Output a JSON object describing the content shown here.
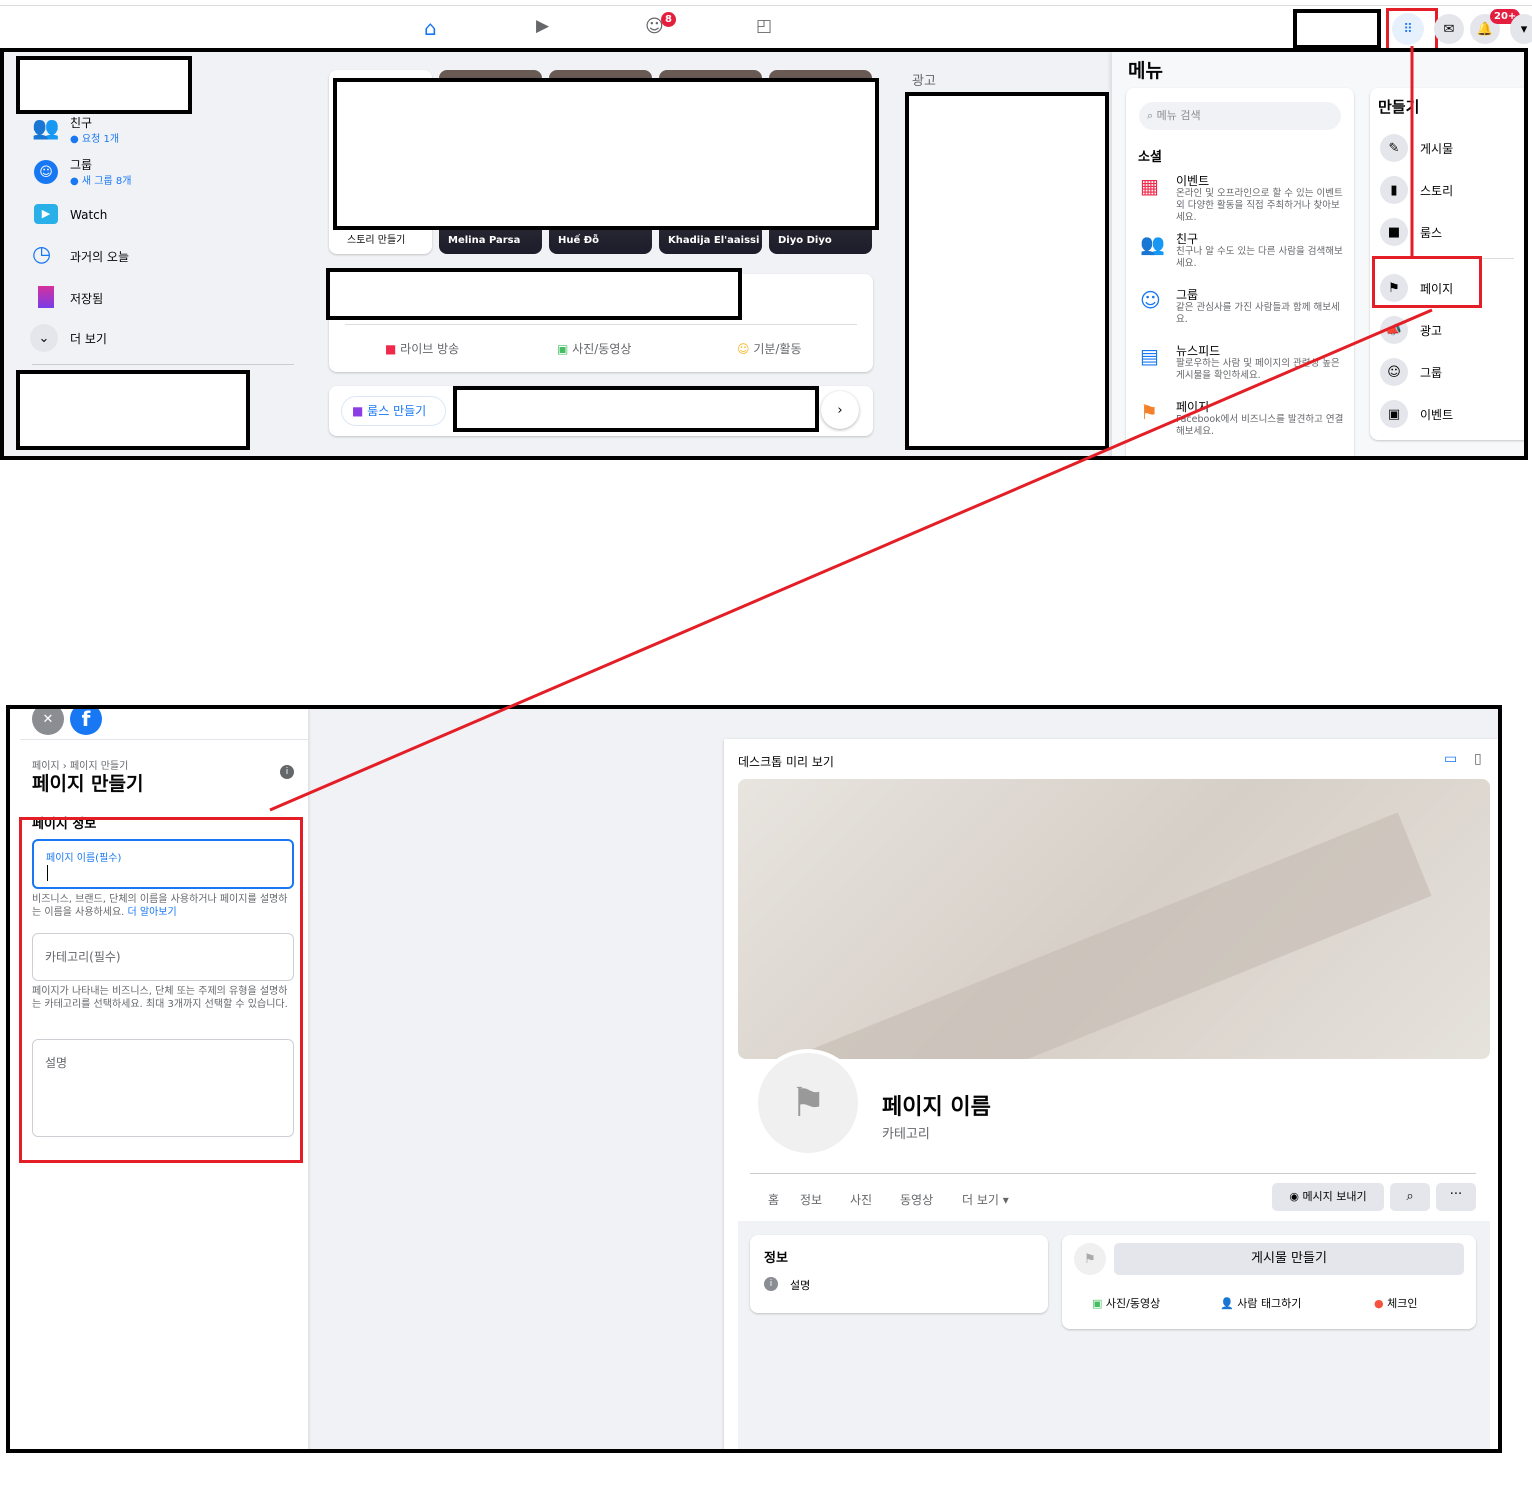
{
  "topbar": {
    "groups_badge": "8",
    "notifications_badge": "20+"
  },
  "sidebar": {
    "items": [
      {
        "label": "친구",
        "sub": "요청 1개",
        "icon": "friends-icon"
      },
      {
        "label": "그룹",
        "sub": "새 그룹 8개",
        "icon": "groups-icon"
      },
      {
        "label": "Watch",
        "icon": "watch-icon"
      },
      {
        "label": "과거의 오늘",
        "icon": "memories-icon"
      },
      {
        "label": "저장됨",
        "icon": "saved-icon"
      },
      {
        "label": "더 보기",
        "icon": "chevron-down-icon"
      }
    ]
  },
  "stories": {
    "create_label": "스토리 만들기",
    "names": [
      "Melina Parsa",
      "Huế Đỗ",
      "Khadija El'aaissi",
      "Diyo Diyo"
    ]
  },
  "composer": {
    "actions": [
      "라이브 방송",
      "사진/동영상",
      "기분/활동"
    ]
  },
  "rooms": {
    "create_label": "룸스 만들기"
  },
  "ads": {
    "title": "광고"
  },
  "menu": {
    "title": "메뉴",
    "search_placeholder": "메뉴 검색",
    "social_heading": "소셜",
    "social": [
      {
        "label": "이벤트",
        "desc": "온라인 및 오프라인으로 할 수 있는 이벤트 외 다양한 활동을 직접 주최하거나 찾아보세요."
      },
      {
        "label": "친구",
        "desc": "친구나 알 수도 있는 다른 사람을 검색해보세요."
      },
      {
        "label": "그룹",
        "desc": "같은 관심사를 가진 사람들과 함께 해보세요."
      },
      {
        "label": "뉴스피드",
        "desc": "팔로우하는 사람 및 페이지의 관련성 높은 게시물을 확인하세요."
      },
      {
        "label": "페이지",
        "desc": "Facebook에서 비즈니스를 발견하고 연결해보세요."
      }
    ],
    "create_heading": "만들기",
    "create": [
      "게시물",
      "스토리",
      "룸스",
      "페이지",
      "광고",
      "그룹",
      "이벤트"
    ]
  },
  "form": {
    "breadcrumb": "페이지 › 페이지 만들기",
    "title": "페이지 만들기",
    "section": "페이지 정보",
    "name_label": "페이지 이름(필수)",
    "name_value": "",
    "name_help": "비즈니스, 브랜드, 단체의 이름을 사용하거나 페이지를 설명하는 이름을 사용하세요.",
    "learn_more": "더 알아보기",
    "category_placeholder": "카테고리(필수)",
    "category_help": "페이지가 나타내는 비즈니스, 단체 또는 주제의 유형을 설명하는 카테고리를 선택하세요. 최대 3개까지 선택할 수 있습니다.",
    "description_placeholder": "설명"
  },
  "preview": {
    "title": "데스크톱 미리 보기",
    "page_name": "페이지 이름",
    "category": "카테고리",
    "tabs": [
      "홈",
      "정보",
      "사진",
      "동영상",
      "더 보기 ▾"
    ],
    "message_button": "메시지 보내기",
    "info_title": "정보",
    "info_item": "설명",
    "create_post": "게시물 만들기",
    "post_actions": [
      "사진/동영상",
      "사람 태그하기",
      "체크인"
    ]
  },
  "colors": {
    "accent": "#1877f2",
    "highlight": "#e41e26"
  }
}
